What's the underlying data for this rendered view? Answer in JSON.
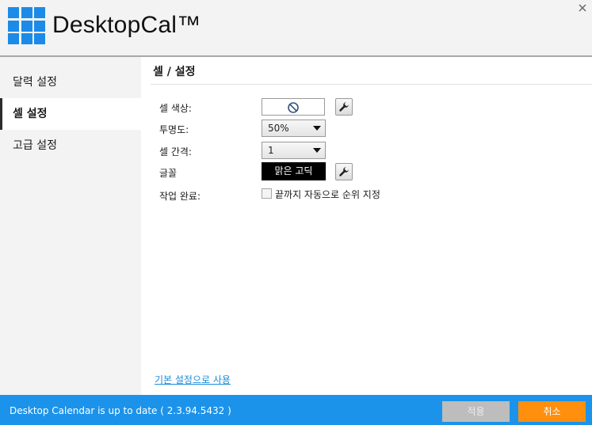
{
  "app": {
    "title": "DesktopCal™",
    "logo_icon": "grid-logo-icon",
    "close_icon": "close-icon",
    "brand_color": "#1c8be8"
  },
  "sidebar": {
    "items": [
      {
        "label": "달력 설정",
        "active": false
      },
      {
        "label": "셀 설정",
        "active": true
      },
      {
        "label": "고급 설정",
        "active": false
      }
    ]
  },
  "section": {
    "title": "셀 / 설정"
  },
  "settings": {
    "cell_color_label": "셀 색상:",
    "cell_color_icon": "no-color-icon",
    "wrench_icon": "wrench-icon",
    "opacity_label": "투명도:",
    "opacity_value": "50%",
    "spacing_label": "셀 간격:",
    "spacing_value": "1",
    "font_label": "글꼴",
    "font_value": "맑은 고딕",
    "task_label": "작업 완료:",
    "task_checkbox_label": "끝까지 자동으로 순위 지정",
    "task_checked": false
  },
  "footer": {
    "default_link": "기본 설정으로 사용",
    "status": "Desktop Calendar is up to date ( 2.3.94.5432 )",
    "apply_label": "적용",
    "cancel_label": "취소",
    "bar_color": "#1c93ea",
    "cancel_color": "#ff8f0d"
  }
}
